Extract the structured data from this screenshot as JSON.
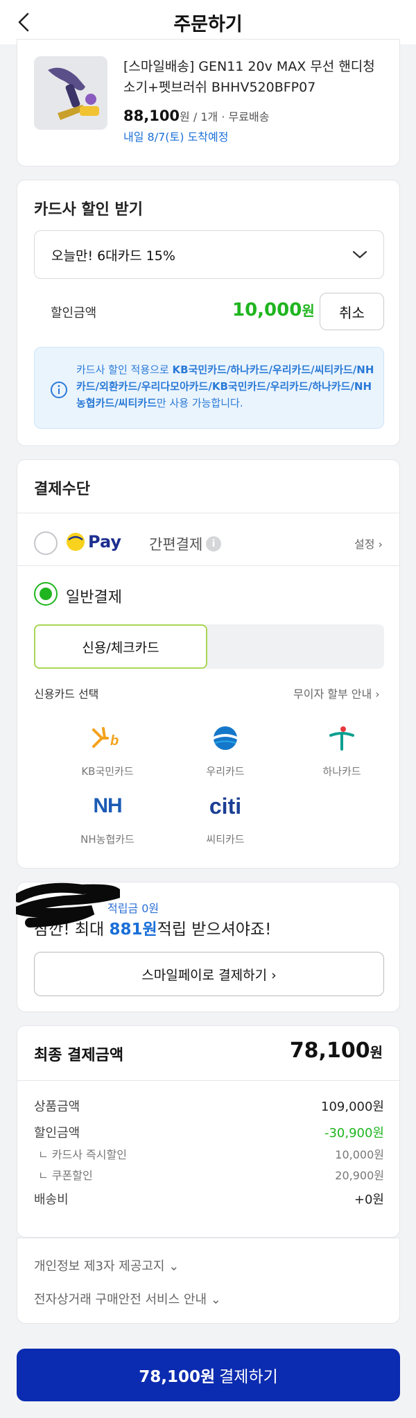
{
  "header": {
    "title": "주문하기"
  },
  "product": {
    "name": "[스마일배송] GEN11 20v MAX 무선 핸디청소기+펫브러쉬 BHHV520BFP07",
    "price": "88,100",
    "price_unit": "원",
    "qty": "/ 1개",
    "shipping": "· 무료배송",
    "delivery": "내일 8/7(토) 도착예정"
  },
  "card_discount": {
    "title": "카드사 할인 받기",
    "selected_option": "오늘만! 6대카드 15%",
    "discount_label": "할인금액",
    "discount_amount": "10,000",
    "discount_unit": "원",
    "cancel_label": "취소",
    "info_prefix": "카드사 할인 적용으로 ",
    "info_cards": "KB국민카드/하나카드/우리카드/씨티카드/NH카드/외환카드/우리다모아카드/KB국민카드/우리카드/하나카드/NH농협카드/씨티카드",
    "info_suffix": "만 사용 가능합니다."
  },
  "payment": {
    "title": "결제수단",
    "pay_brand": "Pay",
    "pay_label": "간편결제",
    "pay_info": "i",
    "pay_setting": "설정 ›",
    "normal_label": "일반결제",
    "segment_selected": "신용/체크카드",
    "cc_select_label": "신용카드 선택",
    "installment_guide": "무이자 할부 안내 ›",
    "banks": [
      {
        "name": "KB국민카드",
        "logo_text": "Kb"
      },
      {
        "name": "우리카드",
        "logo_text": ""
      },
      {
        "name": "하나카드",
        "logo_text": ""
      },
      {
        "name": "NH농협카드",
        "logo_text": "NH"
      },
      {
        "name": "씨티카드",
        "logo_text": "citi"
      }
    ]
  },
  "promo": {
    "small_text": "적립금 0원",
    "big_prefix": "잠깐! 최대 ",
    "big_amount": "881원",
    "big_suffix": "적립 받으셔야죠!",
    "button_label": "스마일페이로 결제하기 ›"
  },
  "totals": {
    "title": "최종 결제금액",
    "amount": "78,100",
    "amount_unit": "원",
    "rows": [
      {
        "label": "상품금액",
        "value": "109,000원"
      },
      {
        "label": "할인금액",
        "value": "-30,900원"
      },
      {
        "label": "ㄴ 카드사 즉시할인",
        "value": "10,000원"
      },
      {
        "label": "ㄴ 쿠폰할인",
        "value": "20,900원"
      },
      {
        "label": "배송비",
        "value": "+0원"
      }
    ]
  },
  "terms": {
    "privacy": "개인정보 제3자 제공고지 ⌄",
    "safety": "전자상거래 구매안전 서비스 안내 ⌄"
  },
  "bottom": {
    "amount": "78,100원",
    "label": "결제하기"
  }
}
